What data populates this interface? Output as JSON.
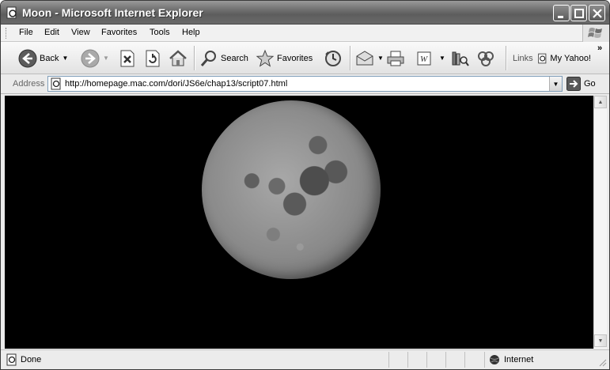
{
  "window": {
    "title": "Moon - Microsoft Internet Explorer"
  },
  "menu": {
    "items": [
      "File",
      "Edit",
      "View",
      "Favorites",
      "Tools",
      "Help"
    ]
  },
  "toolbar": {
    "back_label": "Back",
    "search_label": "Search",
    "favorites_label": "Favorites",
    "links_label": "Links",
    "my_yahoo_label": "My Yahoo!"
  },
  "address": {
    "label": "Address",
    "url": "http://homepage.mac.com/dori/JS6e/chap13/script07.html",
    "go_label": "Go"
  },
  "status": {
    "text": "Done",
    "zone": "Internet"
  }
}
